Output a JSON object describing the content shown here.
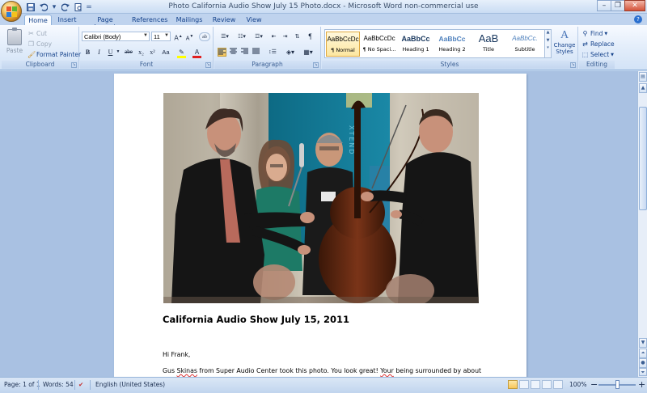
{
  "window": {
    "title": "Photo California Audio Show July 15 Photo.docx - Microsoft Word non-commercial use"
  },
  "qat": {
    "save_icon": "save-icon",
    "undo_icon": "undo-icon",
    "redo_icon": "redo-icon",
    "print_preview_icon": "print-preview-icon",
    "customize_icon": "customize-qat-icon"
  },
  "tabs": [
    {
      "label": "Home",
      "active": true
    },
    {
      "label": "Insert"
    },
    {
      "label": "Page Layout"
    },
    {
      "label": "References"
    },
    {
      "label": "Mailings"
    },
    {
      "label": "Review"
    },
    {
      "label": "View"
    }
  ],
  "ribbon": {
    "clipboard": {
      "label": "Clipboard",
      "paste": "Paste",
      "cut": "Cut",
      "copy": "Copy",
      "format_painter": "Format Painter"
    },
    "font": {
      "label": "Font",
      "font_name": "Calibri (Body)",
      "font_size": "11",
      "grow": "A",
      "shrink": "A",
      "clear": "ab",
      "bold": "B",
      "italic": "I",
      "underline": "U",
      "strike": "abe",
      "sub": "x₂",
      "sup": "x²",
      "case": "Aa",
      "font_color": "A"
    },
    "paragraph": {
      "label": "Paragraph",
      "pilcrow": "¶"
    },
    "styles": {
      "label": "Styles",
      "items": [
        {
          "sample": "AaBbCcDc",
          "name": "¶ Normal",
          "selected": true
        },
        {
          "sample": "AaBbCcDc",
          "name": "¶ No Spaci..."
        },
        {
          "sample": "AaBbCc",
          "name": "Heading 1"
        },
        {
          "sample": "AaBbCc",
          "name": "Heading 2"
        },
        {
          "sample": "AaB",
          "name": "Title"
        },
        {
          "sample": "AaBbCc.",
          "name": "Subtitle"
        }
      ],
      "change_styles_line1": "Change",
      "change_styles_line2": "Styles"
    },
    "editing": {
      "label": "Editing",
      "find": "Find",
      "replace": "Replace",
      "select": "Select"
    }
  },
  "document": {
    "heading": "California Audio Show July 15, 2011",
    "greeting": "Hi Frank,",
    "body_line1_a": "Gus ",
    "body_line1_name": "Skinas",
    "body_line1_b": " from Super Audio Center took this photo.  You look great!  ",
    "body_line1_your": "Your",
    "body_line1_c": " being surrounded by about"
  },
  "status": {
    "page": "Page: 1 of 1",
    "words": "Words: 54",
    "language": "English (United States)",
    "zoom": "100%",
    "zoom_minus": "−",
    "zoom_plus": "+"
  },
  "colors": {
    "ribbon_text": "#15428b",
    "font_color_swatch": "#e02020",
    "highlight_swatch": "#ffff00",
    "selection_accent": "#f7c65a"
  }
}
